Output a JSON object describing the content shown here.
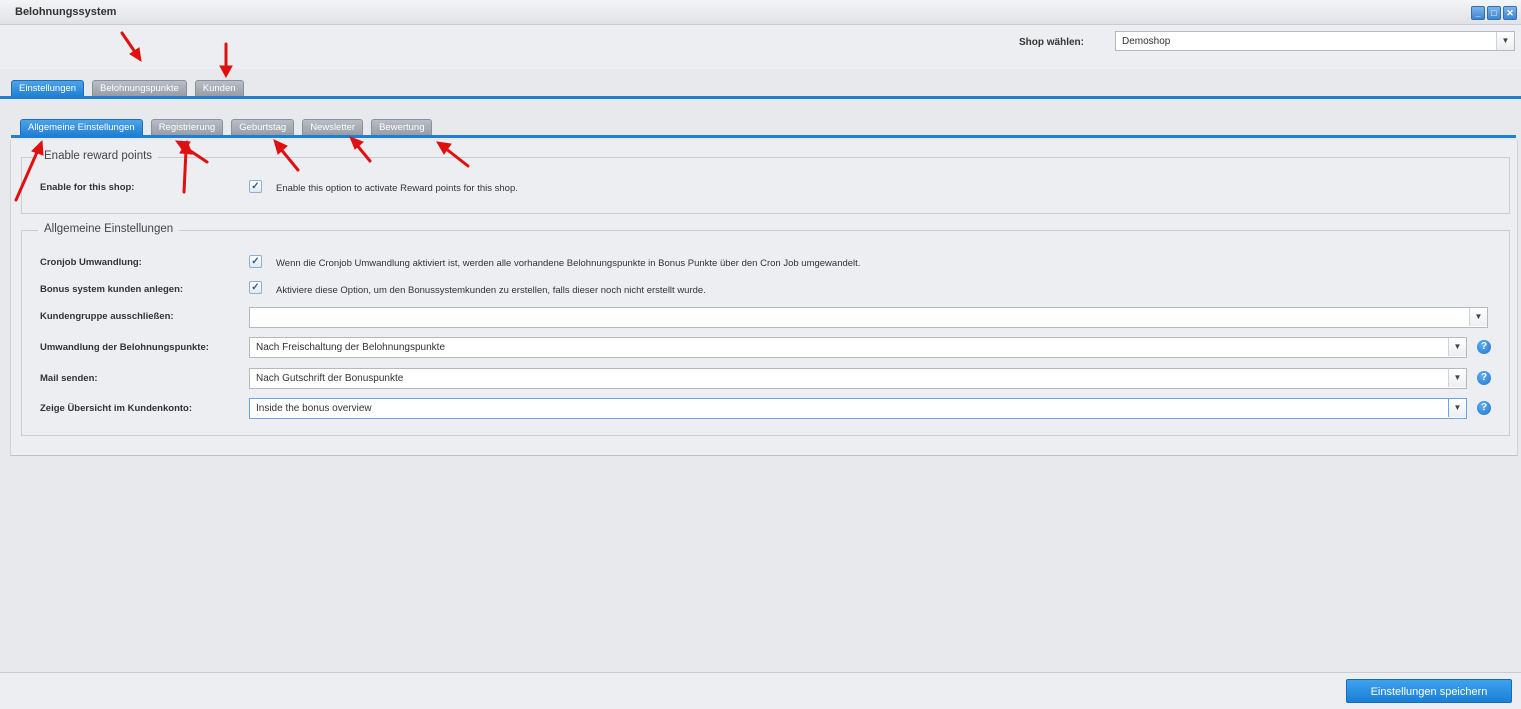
{
  "window": {
    "title": "Belohnungssystem"
  },
  "shop": {
    "label": "Shop wählen:",
    "value": "Demoshop"
  },
  "main_tabs": [
    {
      "label": "Einstellungen",
      "active": true
    },
    {
      "label": "Belohnungspunkte",
      "active": false
    },
    {
      "label": "Kunden",
      "active": false
    }
  ],
  "sub_tabs": [
    {
      "label": "Allgemeine Einstellungen",
      "active": true
    },
    {
      "label": "Registrierung",
      "active": false
    },
    {
      "label": "Geburtstag",
      "active": false
    },
    {
      "label": "Newsletter",
      "active": false
    },
    {
      "label": "Bewertung",
      "active": false
    }
  ],
  "reward": {
    "legend": "Enable reward points",
    "enable_label": "Enable for this shop:",
    "enable_checked": true,
    "enable_desc": "Enable this option to activate Reward points for this shop."
  },
  "general": {
    "legend": "Allgemeine Einstellungen",
    "cron_label": "Cronjob Umwandlung:",
    "cron_checked": true,
    "cron_desc": "Wenn die Cronjob Umwandlung aktiviert ist, werden alle vorhandene Belohnungspunkte in Bonus Punkte über den Cron Job umgewandelt.",
    "bonus_label": "Bonus system kunden anlegen:",
    "bonus_checked": true,
    "bonus_desc": "Aktiviere diese Option, um den Bonussystemkunden zu erstellen, falls dieser noch nicht erstellt wurde.",
    "exclude_label": "Kundengruppe ausschließen:",
    "exclude_value": "",
    "conversion_label": "Umwandlung der Belohnungspunkte:",
    "conversion_value": "Nach Freischaltung der Belohnungspunkte",
    "mail_label": "Mail senden:",
    "mail_value": "Nach Gutschrift der Bonuspunkte",
    "overview_label": "Zeige Übersicht im Kundenkonto:",
    "overview_value": "Inside the bonus overview"
  },
  "footer": {
    "save_label": "Einstellungen speichern"
  },
  "icons": {
    "checkmark": "✓",
    "dropdown": "▼",
    "help": "?",
    "minimize": "_",
    "maximize": "□",
    "close": "✕"
  },
  "colors": {
    "accent": "#1f7fd2",
    "tab_inactive": "#a5abb3",
    "annotation_arrow": "#e01010"
  }
}
